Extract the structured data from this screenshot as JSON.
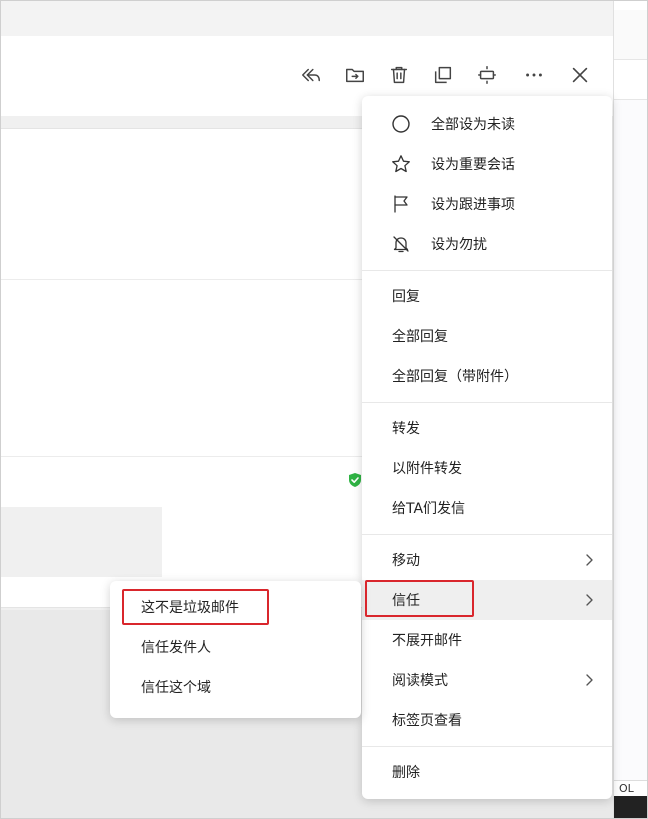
{
  "menu": {
    "group1": [
      {
        "label": "全部设为未读",
        "icon": "circle-icon"
      },
      {
        "label": "设为重要会话",
        "icon": "star-icon"
      },
      {
        "label": "设为跟进事项",
        "icon": "flag-icon"
      },
      {
        "label": "设为勿扰",
        "icon": "bell-off-icon"
      }
    ],
    "group2": [
      "回复",
      "全部回复",
      "全部回复（带附件）"
    ],
    "group3": [
      "转发",
      "以附件转发",
      "给TA们发信"
    ],
    "group4": [
      {
        "label": "移动",
        "has_submenu": true
      },
      {
        "label": "信任",
        "has_submenu": true
      },
      {
        "label": "不展开邮件",
        "has_submenu": false
      },
      {
        "label": "阅读模式",
        "has_submenu": true
      },
      {
        "label": "标签页查看",
        "has_submenu": false
      }
    ],
    "group5": [
      "删除"
    ]
  },
  "submenu": {
    "items": [
      "这不是垃圾邮件",
      "信任发件人",
      "信任这个域"
    ]
  },
  "toolbar": {
    "icons": [
      "reply-all-icon",
      "move-to-folder-icon",
      "trash-icon",
      "copy-icon",
      "expand-icon",
      "more-icon",
      "close-icon"
    ]
  },
  "side": {
    "partial_text": "OL"
  },
  "colors": {
    "highlight": "#d9262c",
    "shield": "#2fb344",
    "hover": "#efefef"
  }
}
